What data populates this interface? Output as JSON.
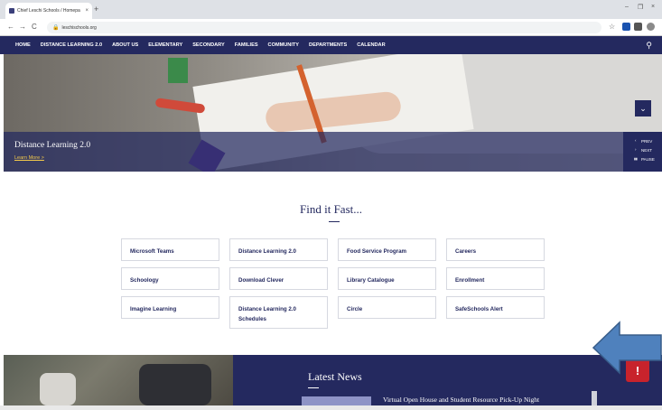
{
  "browser": {
    "tab_title": "Chief Leschi Schools / Homepa",
    "tab_close": "×",
    "new_tab": "+",
    "url": "leschischools.org",
    "win_min": "–",
    "win_restore": "❐",
    "win_close": "×",
    "back": "←",
    "forward": "→",
    "reload": "C",
    "lock": "🔒",
    "star": "☆"
  },
  "nav": {
    "items": [
      "HOME",
      "DISTANCE LEARNING 2.0",
      "ABOUT US",
      "ELEMENTARY",
      "SECONDARY",
      "FAMILIES",
      "COMMUNITY",
      "DEPARTMENTS",
      "CALENDAR"
    ]
  },
  "hero": {
    "title": "Distance Learning 2.0",
    "link": "Learn More >",
    "expand": "⌄",
    "prev": "PREV",
    "next": "NEXT",
    "pause": "PAUSE",
    "prev_icon": "‹",
    "next_icon": "›",
    "pause_icon": "▮▮"
  },
  "find_it_fast": {
    "title": "Find it Fast...",
    "links": [
      "Microsoft Teams",
      "Distance Learning 2.0",
      "Food Service Program",
      "Careers",
      "Schoology",
      "Download Clever",
      "Library Catalogue",
      "Enrollment",
      "Imagine Learning",
      "Distance Learning 2.0 Schedules",
      "Circle",
      "SafeSchools Alert"
    ]
  },
  "news": {
    "title": "Latest News",
    "headline": "Virtual Open House and Student Resource Pick-Up Night",
    "alert": "!"
  },
  "colors": {
    "brand_navy": "#24295f",
    "link_gold": "#f3c94b",
    "alert_red": "#c8232c",
    "arrow_blue": "#4f81bd"
  }
}
